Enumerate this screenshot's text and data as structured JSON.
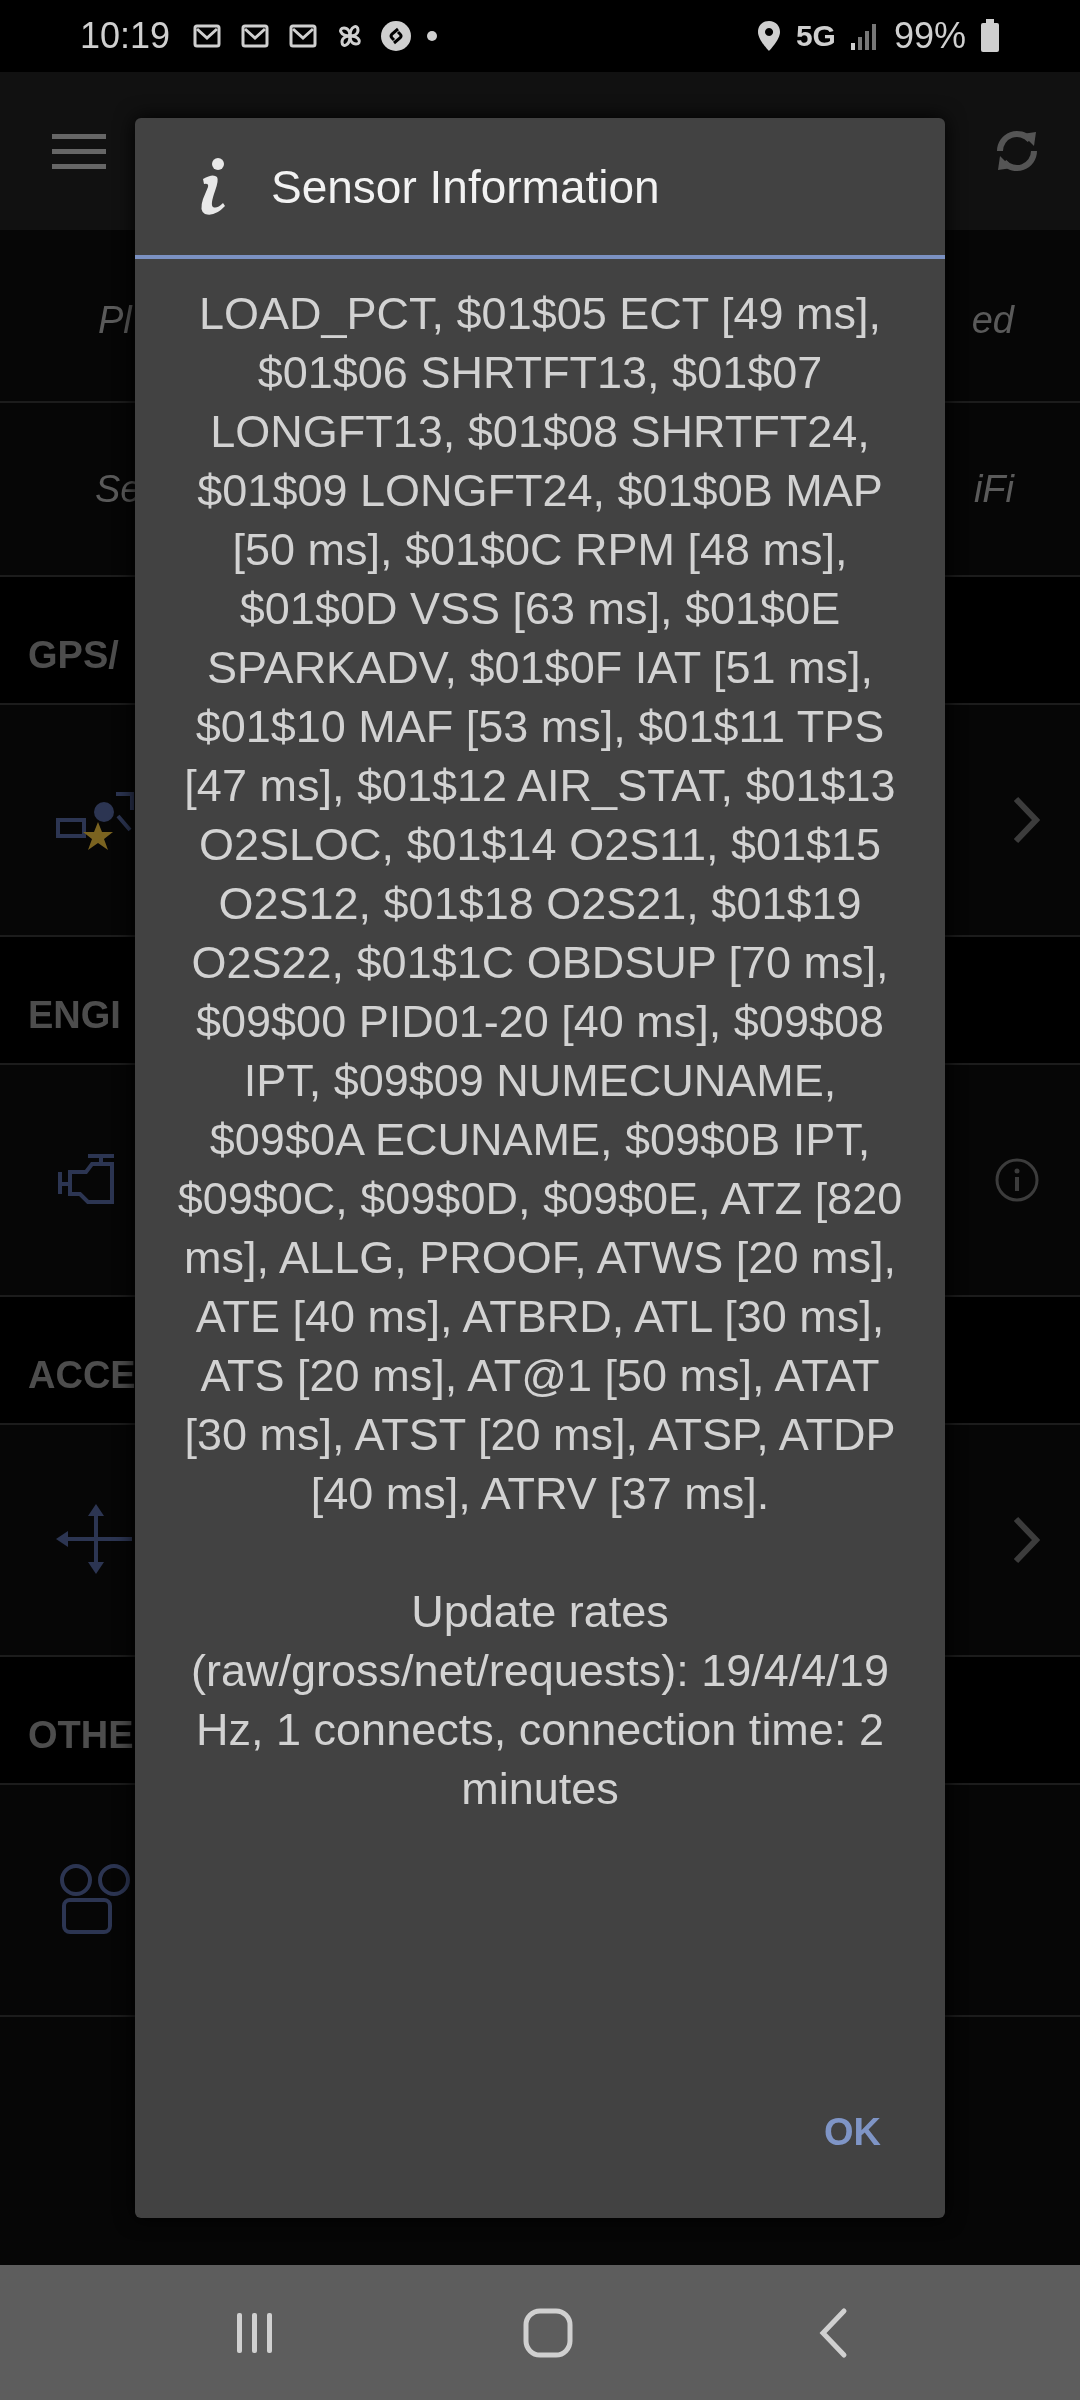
{
  "status_bar": {
    "time": "10:19",
    "network": "5G",
    "battery": "99%"
  },
  "background": {
    "rows": [
      {
        "kind": "note",
        "left": "Pl",
        "right": "ed"
      },
      {
        "kind": "note",
        "left": "Se",
        "right": "iFi"
      },
      {
        "kind": "header",
        "left": "GPS/"
      },
      {
        "kind": "entry",
        "chevron": true,
        "info": false
      },
      {
        "kind": "header",
        "left": "ENGI"
      },
      {
        "kind": "entry",
        "chevron": false,
        "info": true
      },
      {
        "kind": "header",
        "left": "ACCE"
      },
      {
        "kind": "entry",
        "chevron": true,
        "info": false
      },
      {
        "kind": "header",
        "left": "OTHE"
      },
      {
        "kind": "entry",
        "chevron": false,
        "info": false
      }
    ]
  },
  "dialog": {
    "title": "Sensor Information",
    "paragraphs": [
      "LOAD_PCT, $01$05 ECT [49 ms], $01$06 SHRTFT13, $01$07 LONGFT13, $01$08 SHRTFT24, $01$09 LONGFT24, $01$0B MAP [50 ms], $01$0C RPM [48 ms], $01$0D VSS [63 ms], $01$0E SPARKADV, $01$0F IAT [51 ms], $01$10 MAF [53 ms], $01$11 TPS [47 ms], $01$12 AIR_STAT, $01$13 O2SLOC, $01$14 O2S11, $01$15 O2S12, $01$18 O2S21, $01$19 O2S22, $01$1C OBDSUP [70 ms], $09$00 PID01-20 [40 ms], $09$08 IPT, $09$09 NUMECUNAME, $09$0A ECUNAME, $09$0B IPT, $09$0C, $09$0D, $09$0E, ATZ [820 ms], ALLG, PROOF, ATWS [20 ms], ATE [40 ms], ATBRD, ATL [30 ms], ATS [20 ms], AT@1 [50 ms], ATAT [30 ms], ATST [20 ms], ATSP, ATDP [40 ms], ATRV [37 ms].",
      "Update rates (raw/gross/net/requests): 19/4/4/19 Hz, 1 connects, connection time: 2 minutes"
    ],
    "button": "OK"
  }
}
